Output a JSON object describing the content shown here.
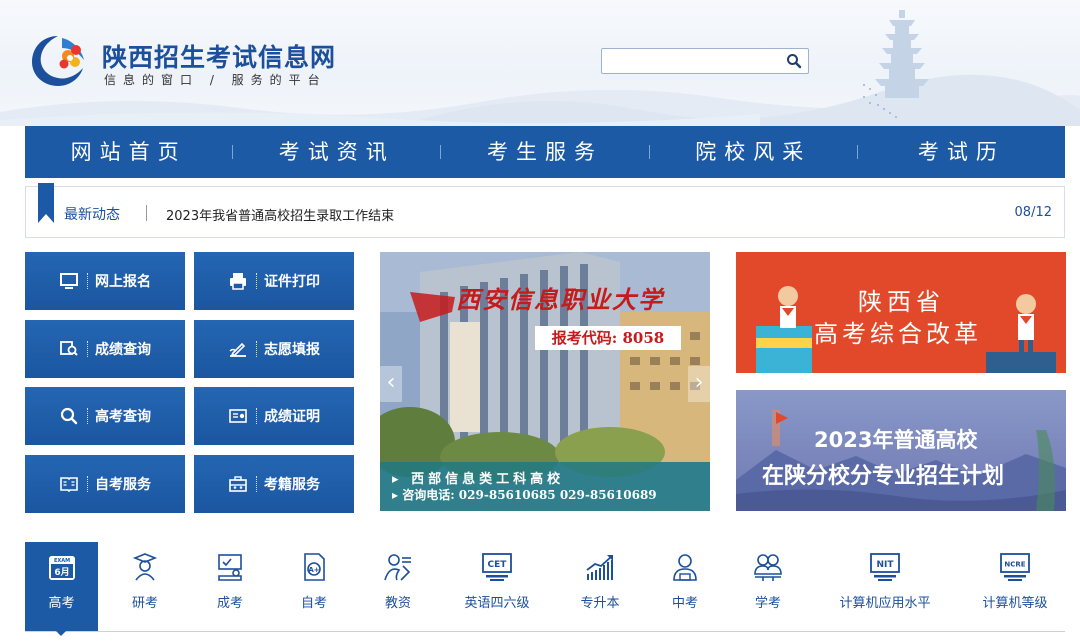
{
  "header": {
    "site_title": "陕西招生考试信息网",
    "slogan": "信息的窗口 / 服务的平台",
    "search": {
      "placeholder": "",
      "value": ""
    }
  },
  "nav": {
    "items": [
      {
        "label": "网站首页"
      },
      {
        "label": "考试资讯"
      },
      {
        "label": "考生服务"
      },
      {
        "label": "院校风采"
      },
      {
        "label": "考试历"
      }
    ]
  },
  "news": {
    "label": "最新动态",
    "headline": "2023年我省普通高校招生录取工作结束",
    "date": "08/12"
  },
  "services": [
    {
      "label": "网上报名",
      "icon": "monitor-icon"
    },
    {
      "label": "证件打印",
      "icon": "printer-icon"
    },
    {
      "label": "成绩查询",
      "icon": "score-search-icon"
    },
    {
      "label": "志愿填报",
      "icon": "sign-pen-icon"
    },
    {
      "label": "高考查询",
      "icon": "search-icon"
    },
    {
      "label": "成绩证明",
      "icon": "certificate-icon"
    },
    {
      "label": "自考服务",
      "icon": "book-icon"
    },
    {
      "label": "考籍服务",
      "icon": "briefcase-icon"
    }
  ],
  "carousel": {
    "title": "西安信息职业大学",
    "code": "报考代码: 8058",
    "line1": "西部信息类工科高校",
    "line2": "咨询电话: 029-85610685  029-85610689"
  },
  "banners": [
    {
      "line1": "陕西省",
      "line2": "高考综合改革"
    },
    {
      "line1": "2023年普通高校",
      "line2": "在陕分校分专业招生计划"
    }
  ],
  "tabs": [
    {
      "label": "高考",
      "icon": "calendar-exam-icon",
      "badge_top": "EXAM",
      "badge_bottom": "6月"
    },
    {
      "label": "研考",
      "icon": "graduate-icon"
    },
    {
      "label": "成考",
      "icon": "adult-exam-icon"
    },
    {
      "label": "自考",
      "icon": "self-exam-icon"
    },
    {
      "label": "教资",
      "icon": "teacher-icon"
    },
    {
      "label": "英语四六级",
      "icon": "cet-icon",
      "badge": "CET"
    },
    {
      "label": "专升本",
      "icon": "growth-chart-icon"
    },
    {
      "label": "中考",
      "icon": "student-icon"
    },
    {
      "label": "学考",
      "icon": "academic-icon"
    },
    {
      "label": "计算机应用水平",
      "icon": "nit-icon",
      "badge": "NIT"
    },
    {
      "label": "计算机等级",
      "icon": "ncre-icon",
      "badge": "NCRE"
    }
  ],
  "colors": {
    "primary": "#1d5aa5",
    "accent_red": "#e2492b"
  }
}
